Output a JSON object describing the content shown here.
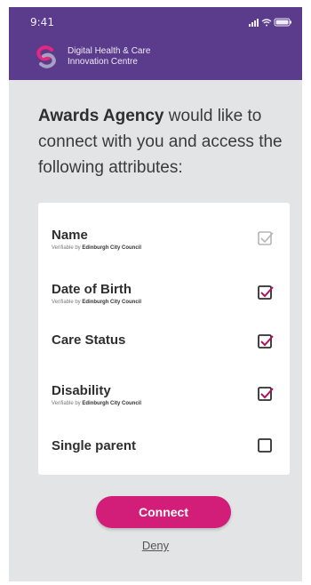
{
  "status_bar": {
    "time": "9:41",
    "icons": [
      "signal-icon",
      "wifi-icon",
      "battery-icon"
    ]
  },
  "brand": {
    "name": "Digital Health & Care Innovation Centre",
    "logo": "dhcic-logo"
  },
  "prompt": {
    "org": "Awards Agency",
    "text": " would like to connect with you and access the following attributes:"
  },
  "attributes": [
    {
      "name": "Name",
      "verified_prefix": "Verifiable by",
      "verified_by": "Edinburgh City Council",
      "checked": true,
      "disabled": true
    },
    {
      "name": "Date of Birth",
      "verified_prefix": "Verifiable by",
      "verified_by": "Edinburgh City Council",
      "checked": true,
      "disabled": false
    },
    {
      "name": "Care Status",
      "verified_prefix": "",
      "verified_by": "",
      "checked": true,
      "disabled": false
    },
    {
      "name": "Disability",
      "verified_prefix": "Verifiable by",
      "verified_by": "Edinburgh City Council",
      "checked": true,
      "disabled": false
    },
    {
      "name": "Single parent",
      "verified_prefix": "",
      "verified_by": "",
      "checked": false,
      "disabled": false
    }
  ],
  "actions": {
    "connect_label": "Connect",
    "deny_label": "Deny"
  },
  "colors": {
    "header": "#5a3b8c",
    "accent": "#d21e79",
    "check": "#8a1a55",
    "check_disabled": "#b5b5b5",
    "background": "#e3e4e6"
  }
}
